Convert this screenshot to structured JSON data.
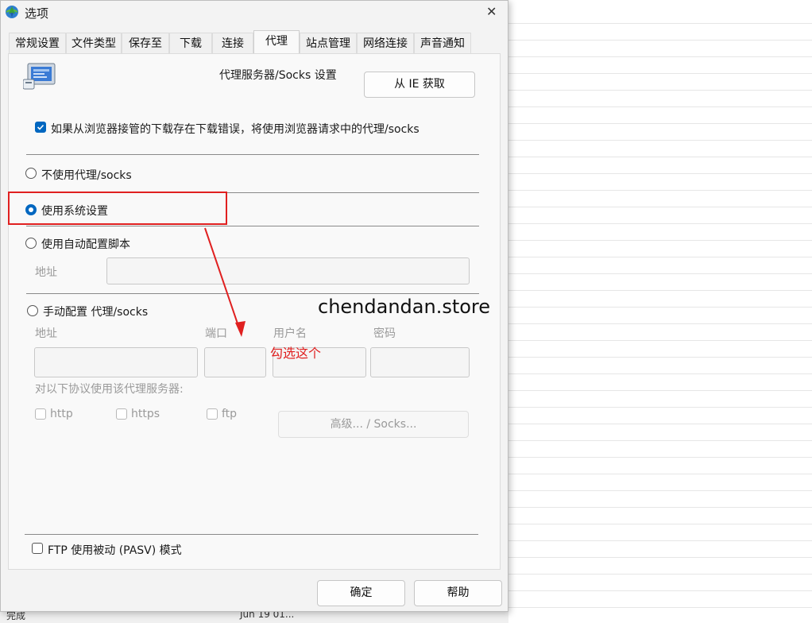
{
  "window": {
    "title": "选项",
    "close_glyph": "✕"
  },
  "tabs": [
    {
      "label": "常规设置"
    },
    {
      "label": "文件类型"
    },
    {
      "label": "保存至"
    },
    {
      "label": "下载"
    },
    {
      "label": "连接"
    },
    {
      "label": "代理",
      "active": true
    },
    {
      "label": "站点管理"
    },
    {
      "label": "网络连接"
    },
    {
      "label": "声音通知"
    }
  ],
  "proxy": {
    "heading": "代理服务器/Socks 设置",
    "get_from_ie": "从 IE 获取",
    "browser_checkbox": {
      "label": "如果从浏览器接管的下载存在下载错误，将使用浏览器请求中的代理/socks",
      "checked": true
    },
    "no_proxy": "不使用代理/socks",
    "system_settings": "使用系统设置",
    "auto_script": "使用自动配置脚本",
    "auto_address_label": "地址",
    "manual": "手动配置 代理/socks",
    "manual_fields": {
      "address": "地址",
      "port": "端口",
      "username": "用户名",
      "password": "密码"
    },
    "protocols_label": "对以下协议使用该代理服务器:",
    "protocols": [
      "http",
      "https",
      "ftp"
    ],
    "advanced": "高级... / Socks...",
    "ftp_passive": "FTP 使用被动 (PASV) 模式",
    "selected": "system_settings"
  },
  "footer": {
    "ok": "确定",
    "help": "帮助"
  },
  "annotation": {
    "text": "勾选这个",
    "color": "#e02020"
  },
  "watermark": "chendandan.store",
  "background": {
    "status_left": "完成",
    "status_date": "Jun 19 01..."
  },
  "colors": {
    "accent": "#0067c0",
    "annotation_red": "#e02020"
  }
}
